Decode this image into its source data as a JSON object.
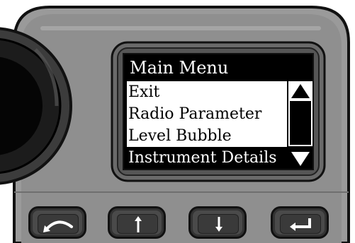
{
  "screen": {
    "title": "Main Menu",
    "items": [
      {
        "label": "Exit",
        "selected": false
      },
      {
        "label": "Radio Parameter",
        "selected": false
      },
      {
        "label": "Level Bubble",
        "selected": false
      },
      {
        "label": "Instrument Details",
        "selected": true
      }
    ],
    "scroll_up_icon": "triangle-up-icon",
    "scroll_down_icon": "triangle-down-icon"
  },
  "keypad": {
    "buttons": [
      {
        "name": "escape-button",
        "icon": "arc-arrow-icon"
      },
      {
        "name": "up-button",
        "icon": "arrow-up-icon"
      },
      {
        "name": "down-button",
        "icon": "arrow-down-icon"
      },
      {
        "name": "enter-button",
        "icon": "enter-return-icon"
      }
    ]
  },
  "colors": {
    "body": "#8c8c8c",
    "bezel": "#5a5a5a",
    "lcd_background": "#000000",
    "lcd_foreground": "#ffffff"
  }
}
